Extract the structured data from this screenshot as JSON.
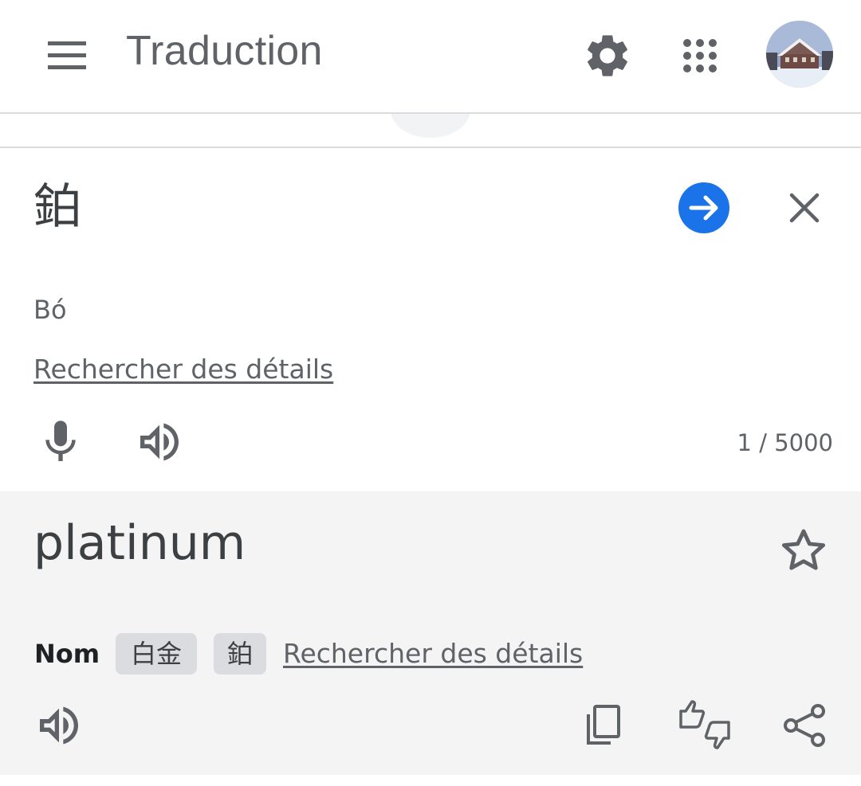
{
  "header": {
    "title": "Traduction",
    "icons": [
      "menu-icon",
      "settings-icon",
      "apps-grid-icon",
      "account-avatar"
    ]
  },
  "source": {
    "text": "鉑",
    "romanization": "Bó",
    "details_link": "Rechercher des détails",
    "char_count": "1 / 5000"
  },
  "result": {
    "text": "platinum",
    "part_of_speech": "Nom",
    "alternatives": [
      "白金",
      "鉑"
    ],
    "details_link": "Rechercher des détails"
  },
  "colors": {
    "accent": "#1a73e8",
    "icon": "#5f6368",
    "result_bg": "#f4f4f4",
    "chip_bg": "#dadce0"
  }
}
